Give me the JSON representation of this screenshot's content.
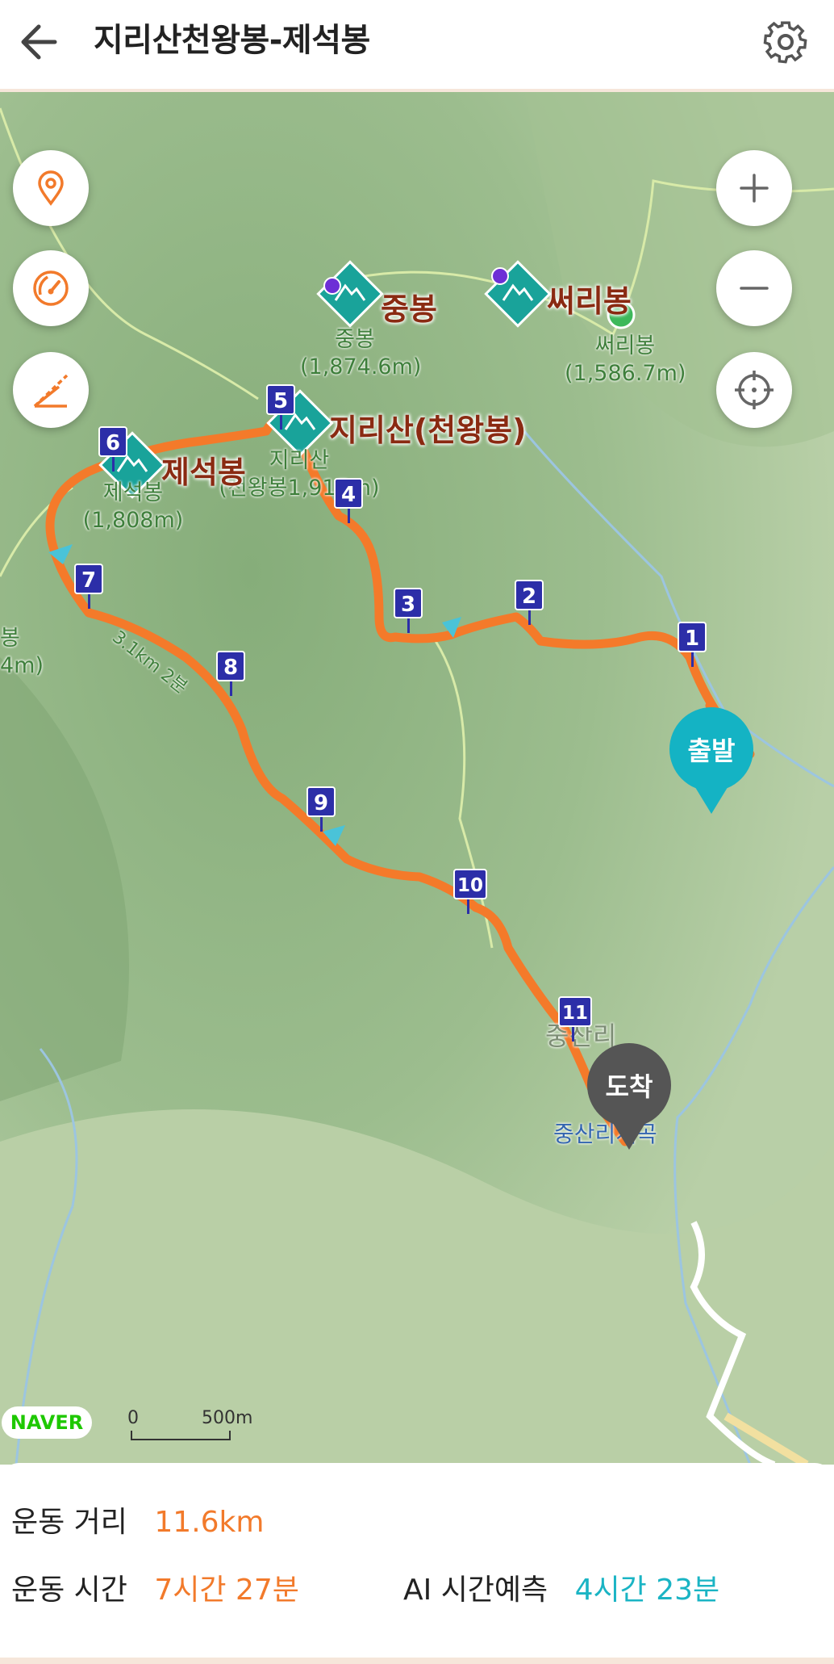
{
  "header": {
    "title": "지리산천왕봉-제석봉",
    "back_icon": "arrow-left-icon",
    "settings_icon": "gear-icon"
  },
  "map": {
    "peaks": [
      {
        "name": "중봉",
        "sub_name": "중봉",
        "elevation": "(1,874.6m)"
      },
      {
        "name": "써리봉",
        "sub_name": "써리봉",
        "elevation": "(1,586.7m)"
      },
      {
        "name": "지리산(천왕봉)",
        "sub_name": "지리산",
        "elevation": "(천왕봉1,915m)"
      },
      {
        "name": "제석봉",
        "sub_name": "제석봉",
        "elevation": "(1,808m)"
      }
    ],
    "edge_label": {
      "name": "봉",
      "elevation": "4m)"
    },
    "trail_label": "3.1km 2분",
    "village_label": "중산리",
    "stop_label": "중산리계곡",
    "waypoints": [
      "1",
      "2",
      "3",
      "4",
      "5",
      "6",
      "7",
      "8",
      "9",
      "10",
      "11"
    ],
    "start_label": "출발",
    "end_label": "도착",
    "provider": "NAVER",
    "scale": {
      "start": "0",
      "end": "500m"
    },
    "controls": {
      "left": [
        "location-pin-icon",
        "speedometer-icon",
        "slope-icon"
      ],
      "right": [
        "zoom-in-icon",
        "zoom-out-icon",
        "crosshair-icon"
      ]
    },
    "colors": {
      "route": "#f47a2a",
      "waypoint": "#2c2ea8",
      "start": "#14b3c4",
      "end": "#555555"
    }
  },
  "stats": {
    "distance_label": "운동 거리",
    "distance_value": "11.6km",
    "time_label": "운동 시간",
    "time_value": "7시간 27분",
    "ai_label": "AI 시간예측",
    "ai_value": "4시간 23분"
  }
}
